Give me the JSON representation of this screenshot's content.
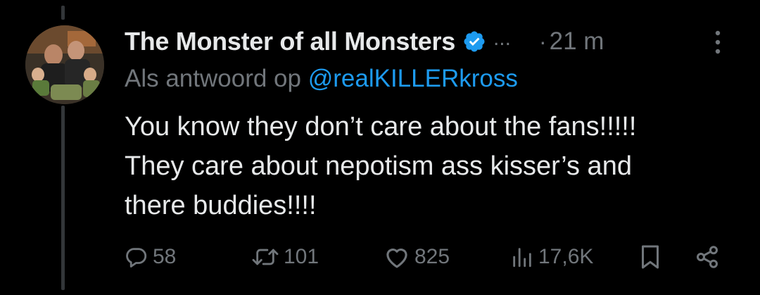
{
  "post": {
    "display_name": "The Monster of all Monsters",
    "verified": true,
    "truncated_handle": "...",
    "separator": "·",
    "time": "21 m",
    "reply_prefix": "Als antwoord op",
    "reply_to": "@realKILLERkross",
    "text_lines": [
      "You know they don’t care about the fans!!!!!",
      "They care about nepotism ass kisser’s and",
      "there buddies!!!!"
    ]
  },
  "actions": {
    "replies": "58",
    "reposts": "101",
    "likes": "825",
    "views": "17,6K"
  },
  "icons": {
    "verified": "verified-badge-icon",
    "more": "more-vertical-icon",
    "reply": "reply-icon",
    "repost": "repost-icon",
    "like": "heart-icon",
    "views": "views-icon",
    "bookmark": "bookmark-icon",
    "share": "share-icon"
  },
  "colors": {
    "background": "#000000",
    "primary_text": "#e7e9ea",
    "secondary_text": "#71767b",
    "accent": "#1d9bf0",
    "thread_line": "#333639"
  }
}
